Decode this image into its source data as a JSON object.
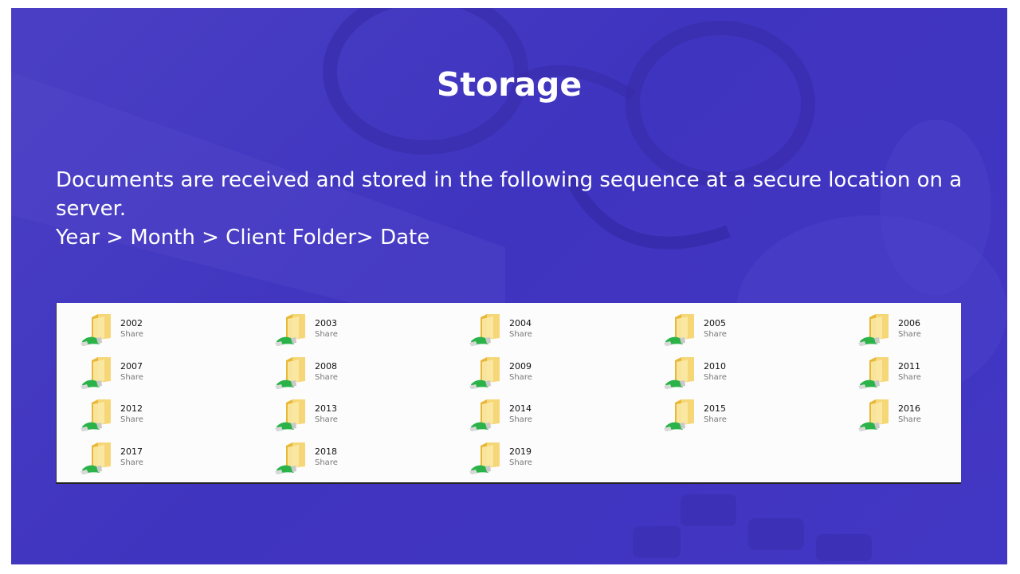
{
  "slide": {
    "title": "Storage",
    "line1": "Documents are received and stored in the following sequence at a secure location on a",
    "line2": "server.",
    "line3": "Year > Month > Client Folder> Date"
  },
  "explorer": {
    "folders": [
      {
        "name": "2002",
        "sub": "Share"
      },
      {
        "name": "2003",
        "sub": "Share"
      },
      {
        "name": "2004",
        "sub": "Share"
      },
      {
        "name": "2005",
        "sub": "Share"
      },
      {
        "name": "2006",
        "sub": "Share"
      },
      {
        "name": "2007",
        "sub": "Share"
      },
      {
        "name": "2008",
        "sub": "Share"
      },
      {
        "name": "2009",
        "sub": "Share"
      },
      {
        "name": "2010",
        "sub": "Share"
      },
      {
        "name": "2011",
        "sub": "Share"
      },
      {
        "name": "2012",
        "sub": "Share"
      },
      {
        "name": "2013",
        "sub": "Share"
      },
      {
        "name": "2014",
        "sub": "Share"
      },
      {
        "name": "2015",
        "sub": "Share"
      },
      {
        "name": "2016",
        "sub": "Share"
      },
      {
        "name": "2017",
        "sub": "Share"
      },
      {
        "name": "2018",
        "sub": "Share"
      },
      {
        "name": "2019",
        "sub": "Share"
      }
    ],
    "icon": "shared-folder-icon"
  },
  "colors": {
    "background": "#4238c2",
    "text": "#ffffff",
    "folder": "#f0c94a",
    "share_cable": "#2bb34a"
  }
}
